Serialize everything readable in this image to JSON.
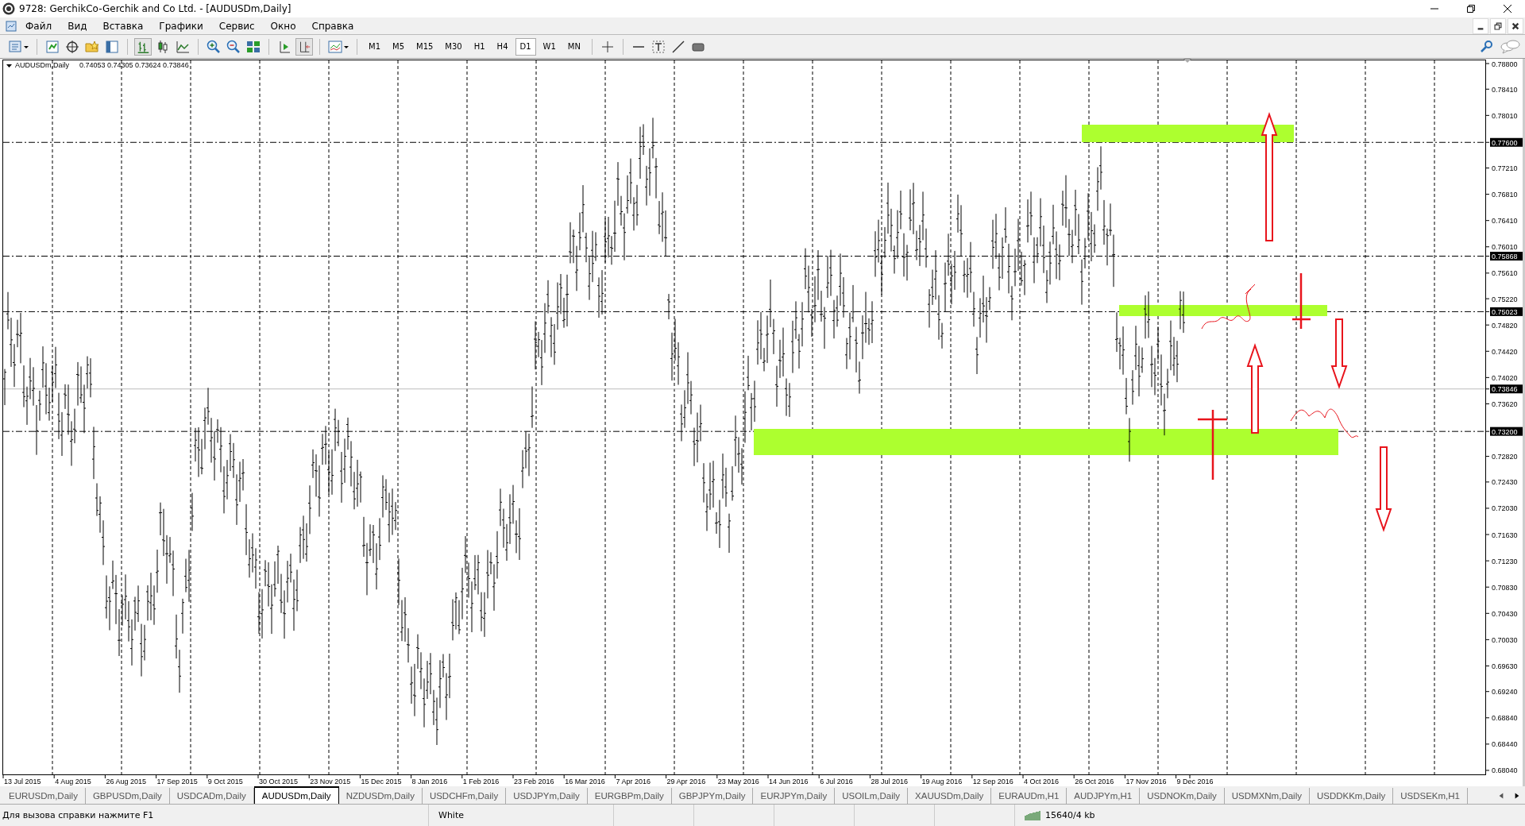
{
  "window": {
    "title": "9728: GerchikCo-Gerchik and Co Ltd. - [AUDUSDm,Daily]"
  },
  "menu": [
    "Файл",
    "Вид",
    "Вставка",
    "Графики",
    "Сервис",
    "Окно",
    "Справка"
  ],
  "timeframes": [
    {
      "label": "M1",
      "selected": false
    },
    {
      "label": "M5",
      "selected": false
    },
    {
      "label": "M15",
      "selected": false
    },
    {
      "label": "M30",
      "selected": false
    },
    {
      "label": "H1",
      "selected": false
    },
    {
      "label": "H4",
      "selected": false
    },
    {
      "label": "D1",
      "selected": true
    },
    {
      "label": "W1",
      "selected": false
    },
    {
      "label": "MN",
      "selected": false
    }
  ],
  "chart": {
    "symbol": "AUDUSDm,Daily",
    "quote": "0.74053 0.74305 0.73624 0.73846",
    "price_labels": [
      {
        "label": "0.78800",
        "kind": "tick"
      },
      {
        "label": "0.78410",
        "kind": "tick"
      },
      {
        "label": "0.78010",
        "kind": "tick"
      },
      {
        "label": "0.77600",
        "kind": "line"
      },
      {
        "label": "0.77210",
        "kind": "tick"
      },
      {
        "label": "0.76810",
        "kind": "tick"
      },
      {
        "label": "0.76410",
        "kind": "tick"
      },
      {
        "label": "0.76010",
        "kind": "tick"
      },
      {
        "label": "0.75868",
        "kind": "line"
      },
      {
        "label": "0.75610",
        "kind": "tick"
      },
      {
        "label": "0.75220",
        "kind": "tick"
      },
      {
        "label": "0.75023",
        "kind": "line"
      },
      {
        "label": "0.74820",
        "kind": "tick"
      },
      {
        "label": "0.74420",
        "kind": "tick"
      },
      {
        "label": "0.74020",
        "kind": "tick"
      },
      {
        "label": "0.73846",
        "kind": "bid"
      },
      {
        "label": "0.73620",
        "kind": "tick"
      },
      {
        "label": "0.73200",
        "kind": "line"
      },
      {
        "label": "0.72820",
        "kind": "tick"
      },
      {
        "label": "0.72430",
        "kind": "tick"
      },
      {
        "label": "0.72030",
        "kind": "tick"
      },
      {
        "label": "0.71630",
        "kind": "tick"
      },
      {
        "label": "0.71230",
        "kind": "tick"
      },
      {
        "label": "0.70830",
        "kind": "tick"
      },
      {
        "label": "0.70430",
        "kind": "tick"
      },
      {
        "label": "0.70030",
        "kind": "tick"
      },
      {
        "label": "0.69630",
        "kind": "tick"
      },
      {
        "label": "0.69240",
        "kind": "tick"
      },
      {
        "label": "0.68840",
        "kind": "tick"
      },
      {
        "label": "0.68440",
        "kind": "tick"
      },
      {
        "label": "0.68040",
        "kind": "tick"
      }
    ],
    "date_labels": [
      "13 Jul 2015",
      "4 Aug 2015",
      "26 Aug 2015",
      "17 Sep 2015",
      "9 Oct 2015",
      "30 Oct 2015",
      "23 Nov 2015",
      "15 Dec 2015",
      "8 Jan 2016",
      "1 Feb 2016",
      "23 Feb 2016",
      "16 Mar 2016",
      "7 Apr 2016",
      "29 Apr 2016",
      "23 May 2016",
      "14 Jun 2016",
      "6 Jul 2016",
      "28 Jul 2016",
      "19 Aug 2016",
      "12 Sep 2016",
      "4 Oct 2016",
      "26 Oct 2016",
      "17 Nov 2016",
      "9 Dec 2016"
    ]
  },
  "tabs": [
    {
      "label": "EURUSDm,Daily",
      "selected": false
    },
    {
      "label": "GBPUSDm,Daily",
      "selected": false
    },
    {
      "label": "USDCADm,Daily",
      "selected": false
    },
    {
      "label": "AUDUSDm,Daily",
      "selected": true
    },
    {
      "label": "NZDUSDm,Daily",
      "selected": false
    },
    {
      "label": "USDCHFm,Daily",
      "selected": false
    },
    {
      "label": "USDJPYm,Daily",
      "selected": false
    },
    {
      "label": "EURGBPm,Daily",
      "selected": false
    },
    {
      "label": "GBPJPYm,Daily",
      "selected": false
    },
    {
      "label": "EURJPYm,Daily",
      "selected": false
    },
    {
      "label": "USOILm,Daily",
      "selected": false
    },
    {
      "label": "XAUUSDm,Daily",
      "selected": false
    },
    {
      "label": "EURAUDm,H1",
      "selected": false
    },
    {
      "label": "AUDJPYm,H1",
      "selected": false
    },
    {
      "label": "USDNOKm,Daily",
      "selected": false
    },
    {
      "label": "USDMXNm,Daily",
      "selected": false
    },
    {
      "label": "USDDKKm,Daily",
      "selected": false
    },
    {
      "label": "USDSEKm,H1",
      "selected": false
    }
  ],
  "status_bar": {
    "help": "Для вызова справки нажмите F1",
    "template": "White",
    "traffic": "15640/4 kb"
  }
}
